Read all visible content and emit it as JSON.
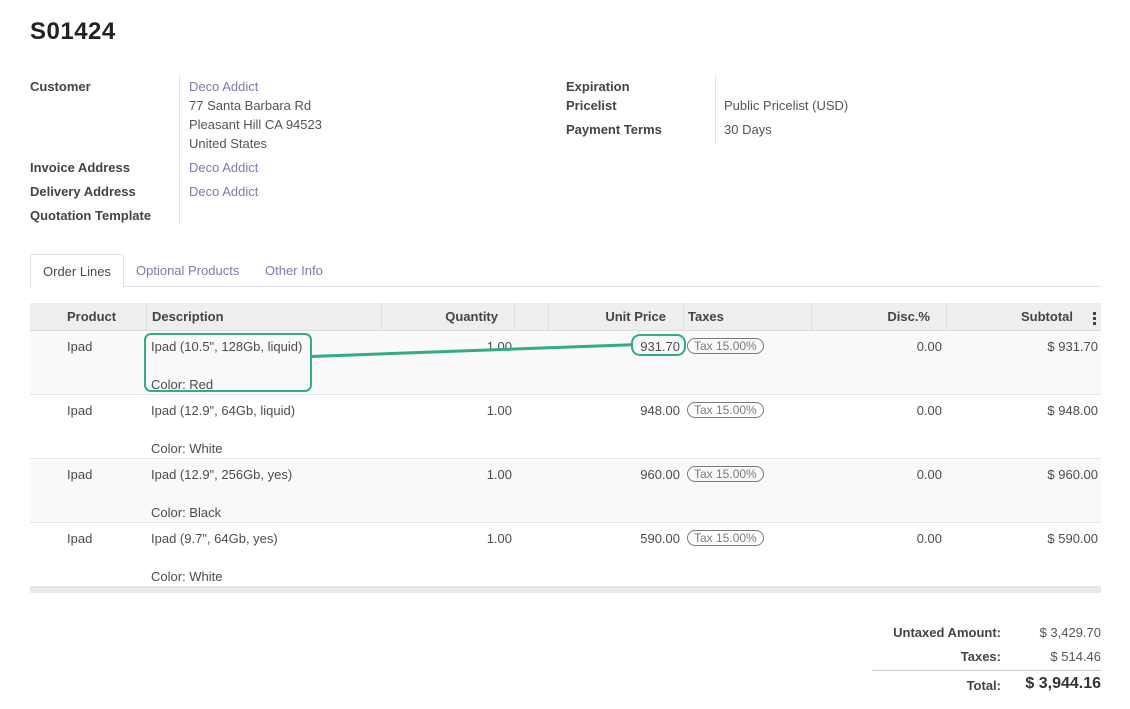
{
  "order": {
    "title": "S01424"
  },
  "customer": {
    "label": "Customer",
    "name": "Deco Addict",
    "address_line1": "77 Santa Barbara Rd",
    "address_line2": "Pleasant Hill CA 94523",
    "address_line3": "United States"
  },
  "invoice_address": {
    "label": "Invoice Address",
    "value": "Deco Addict"
  },
  "delivery_address": {
    "label": "Delivery Address",
    "value": "Deco Addict"
  },
  "quotation_template": {
    "label": "Quotation Template",
    "value": ""
  },
  "expiration": {
    "label": "Expiration",
    "value": ""
  },
  "pricelist": {
    "label": "Pricelist",
    "value": "Public Pricelist (USD)"
  },
  "payment_terms": {
    "label": "Payment Terms",
    "value": "30 Days"
  },
  "tabs": [
    {
      "label": "Order Lines",
      "active": true
    },
    {
      "label": "Optional Products",
      "active": false
    },
    {
      "label": "Other Info",
      "active": false
    }
  ],
  "table": {
    "headers": {
      "product": "Product",
      "description": "Description",
      "quantity": "Quantity",
      "unit_price": "Unit Price",
      "taxes": "Taxes",
      "discount": "Disc.%",
      "subtotal": "Subtotal"
    },
    "rows": [
      {
        "product": "Ipad",
        "description": "Ipad (10.5\", 128Gb, liquid)",
        "variant": "Color: Red",
        "quantity": "1.00",
        "unit_price": "931.70",
        "tax": "Tax 15.00%",
        "discount": "0.00",
        "subtotal": "$ 931.70"
      },
      {
        "product": "Ipad",
        "description": "Ipad (12.9\", 64Gb, liquid)",
        "variant": "Color: White",
        "quantity": "1.00",
        "unit_price": "948.00",
        "tax": "Tax 15.00%",
        "discount": "0.00",
        "subtotal": "$ 948.00"
      },
      {
        "product": "Ipad",
        "description": "Ipad (12.9\", 256Gb, yes)",
        "variant": "Color: Black",
        "quantity": "1.00",
        "unit_price": "960.00",
        "tax": "Tax 15.00%",
        "discount": "0.00",
        "subtotal": "$ 960.00"
      },
      {
        "product": "Ipad",
        "description": "Ipad (9.7\", 64Gb, yes)",
        "variant": "Color: White",
        "quantity": "1.00",
        "unit_price": "590.00",
        "tax": "Tax 15.00%",
        "discount": "0.00",
        "subtotal": "$ 590.00"
      }
    ]
  },
  "totals": {
    "untaxed_label": "Untaxed Amount:",
    "untaxed_value": "$ 3,429.70",
    "taxes_label": "Taxes:",
    "taxes_value": "$ 514.46",
    "total_label": "Total:",
    "total_value": "$ 3,944.16"
  },
  "colors": {
    "link": "#7c7bad",
    "highlight": "#33aa88"
  },
  "icons": {
    "column_options": "kebab-icon"
  }
}
